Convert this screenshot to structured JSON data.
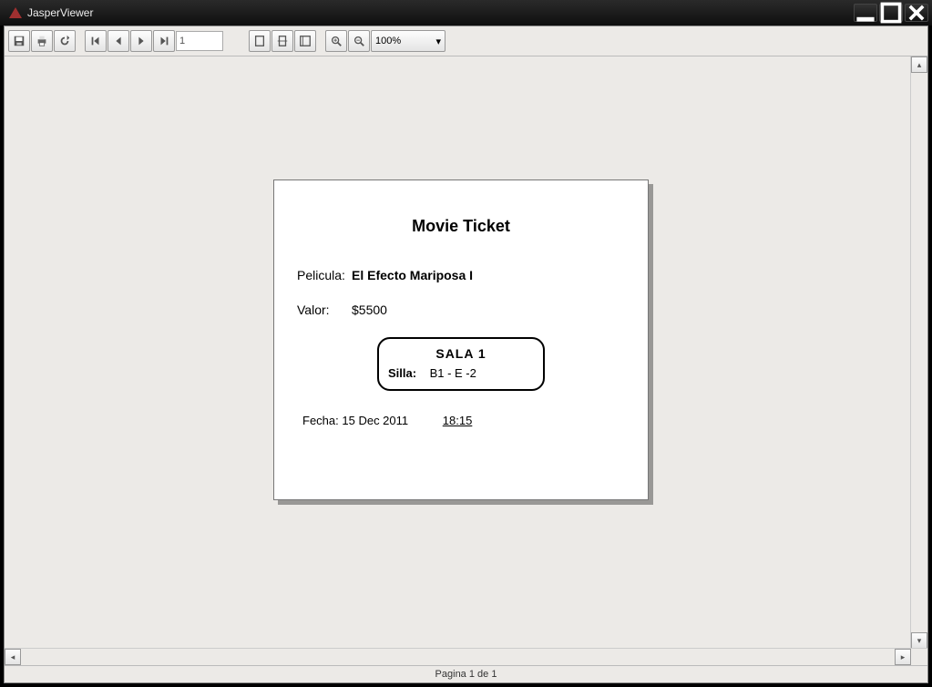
{
  "window": {
    "title": "JasperViewer"
  },
  "toolbar": {
    "page_input": "1",
    "zoom_value": "100%"
  },
  "ticket": {
    "title": "Movie Ticket",
    "movie_label": "Pelicula:",
    "movie_value": "El Efecto Mariposa I",
    "price_label": "Valor:",
    "price_value": "$5500",
    "room_label": "SALA  1",
    "seat_label": "Silla:",
    "seat_value": "B1 - E   -2",
    "date_label": "Fecha:",
    "date_value": "15 Dec 2011",
    "time_value": "18:15"
  },
  "status": {
    "text": "Pagina 1 de 1"
  }
}
